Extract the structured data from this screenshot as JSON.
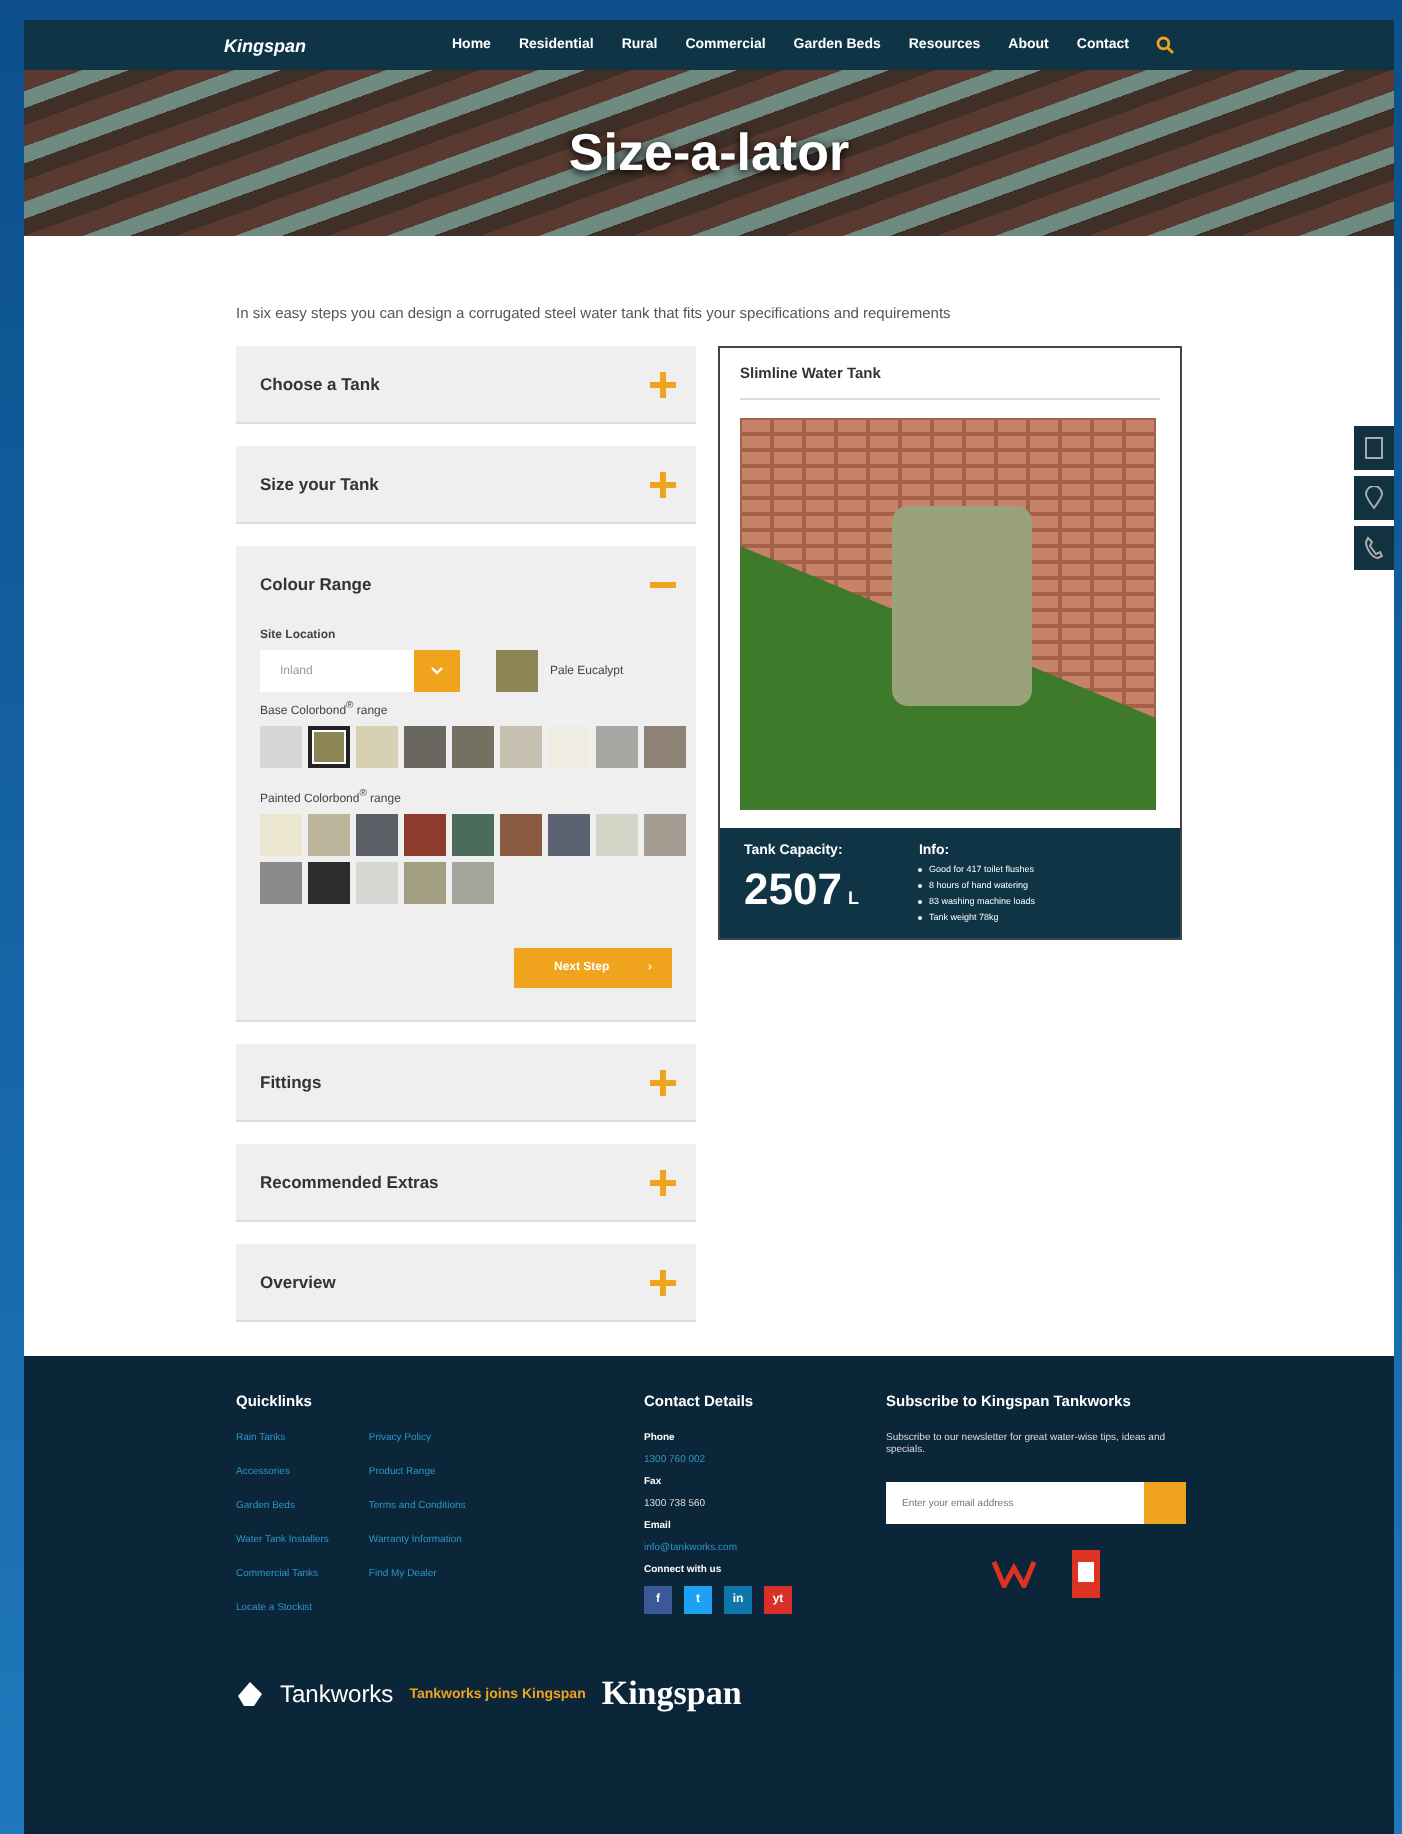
{
  "nav": {
    "logo": "Kingspan",
    "items": [
      {
        "label": "Home"
      },
      {
        "label": "Residential"
      },
      {
        "label": "Rural"
      },
      {
        "label": "Commercial"
      },
      {
        "label": "Garden Beds"
      },
      {
        "label": "Resources"
      },
      {
        "label": "About"
      },
      {
        "label": "Contact"
      }
    ]
  },
  "hero": {
    "title": "Size-a-lator"
  },
  "intro": "In six easy steps you can design a corrugated steel water tank that fits your specifications and requirements",
  "steps": [
    {
      "title": "Choose a Tank",
      "expanded": false
    },
    {
      "title": "Size your Tank",
      "expanded": false
    },
    {
      "title": "Colour Range",
      "expanded": true
    },
    {
      "title": "Fittings",
      "expanded": false
    },
    {
      "title": "Recommended Extras",
      "expanded": false
    },
    {
      "title": "Overview",
      "expanded": false
    }
  ],
  "colour_range": {
    "site_label": "Site Location",
    "site_value": "Inland",
    "chosen_name": "Pale Eucalypt",
    "base_label": "Base Colorbond$^{®}$ range",
    "base_swatches": [
      {
        "color": "#d6d6d4",
        "selected": false
      },
      {
        "color": "#8c8657",
        "selected": true
      },
      {
        "color": "#d8d0b2",
        "selected": false
      },
      {
        "color": "#6a6660",
        "selected": false
      },
      {
        "color": "#747062",
        "selected": false
      },
      {
        "color": "#c6c0b0",
        "selected": false
      },
      {
        "color": "#efece2",
        "selected": false
      },
      {
        "color": "#a7a6a2",
        "selected": false
      },
      {
        "color": "#8e8276",
        "selected": false
      }
    ],
    "painted_label": "Painted Colorbond$^{®}$ range",
    "painted_swatches": [
      {
        "color": "#ebe6d0"
      },
      {
        "color": "#bcb59c"
      },
      {
        "color": "#5b6066"
      },
      {
        "color": "#8e3a2c"
      },
      {
        "color": "#4b6b5c"
      },
      {
        "color": "#8a5a40"
      },
      {
        "color": "#5b6272"
      },
      {
        "color": "#d4d5c6"
      },
      {
        "color": "#a49c90"
      },
      {
        "color": "#8a8a88"
      },
      {
        "color": "#2c2c2c"
      },
      {
        "color": "#d6d6d2"
      },
      {
        "color": "#a29e82"
      },
      {
        "color": "#a4a69c"
      }
    ],
    "next_label": "Next Step",
    "next_icon": "›"
  },
  "preview": {
    "title": "Slimline Water Tank",
    "capacity_label": "Tank Capacity:",
    "capacity": "2507",
    "unit": "L",
    "info_label": "Info:",
    "info": [
      "Good for 417 toilet flushes",
      "8 hours of hand watering",
      "83 washing machine loads",
      "Tank weight 78kg"
    ]
  },
  "footer": {
    "quicklinks_title": "Quicklinks",
    "quicklinks": [
      "Rain Tanks",
      "Accessories",
      "Garden Beds",
      "Water Tank Installers",
      "Commercial Tanks",
      "Locate a Stockist",
      "Privacy Policy",
      "Product Range",
      "Terms and Conditions",
      "Warranty Information",
      "Find My Dealer"
    ],
    "contact_title": "Contact Details",
    "phone_label": "Phone",
    "phone": "1300 760 002",
    "fax_label": "Fax",
    "fax": "1300 738 560",
    "email_label": "Email",
    "email": "info@tankworks.com",
    "connect_label": "Connect with us",
    "social": [
      {
        "label": "f",
        "color": "#3b5998"
      },
      {
        "label": "t",
        "color": "#1da1f2"
      },
      {
        "label": "in",
        "color": "#0e76a8"
      },
      {
        "label": "yt",
        "color": "#d9302a"
      }
    ],
    "subscribe_title": "Subscribe to Kingspan Tankworks",
    "subscribe_text": "Subscribe to our newsletter for great water-wise tips, ideas and specials.",
    "email_placeholder": "Enter your email address",
    "brand": "Tankworks",
    "tagline": "Tankworks joins Kingspan",
    "brand2": "Kingspan"
  }
}
